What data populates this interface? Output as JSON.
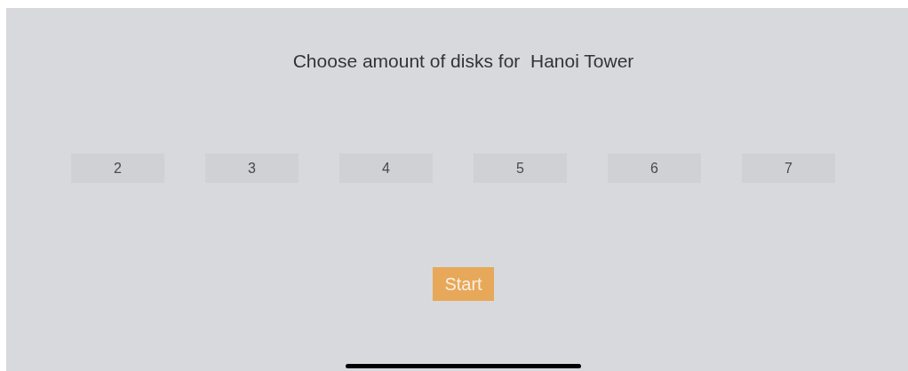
{
  "title": "Choose amount of disks for  Hanoi Tower",
  "disk_options": [
    {
      "label": "2",
      "selected": false
    },
    {
      "label": "3",
      "selected": false
    },
    {
      "label": "4",
      "selected": false
    },
    {
      "label": "5",
      "selected": false
    },
    {
      "label": "6",
      "selected": false
    },
    {
      "label": "7",
      "selected": false
    }
  ],
  "start_button": {
    "label": "Start"
  }
}
